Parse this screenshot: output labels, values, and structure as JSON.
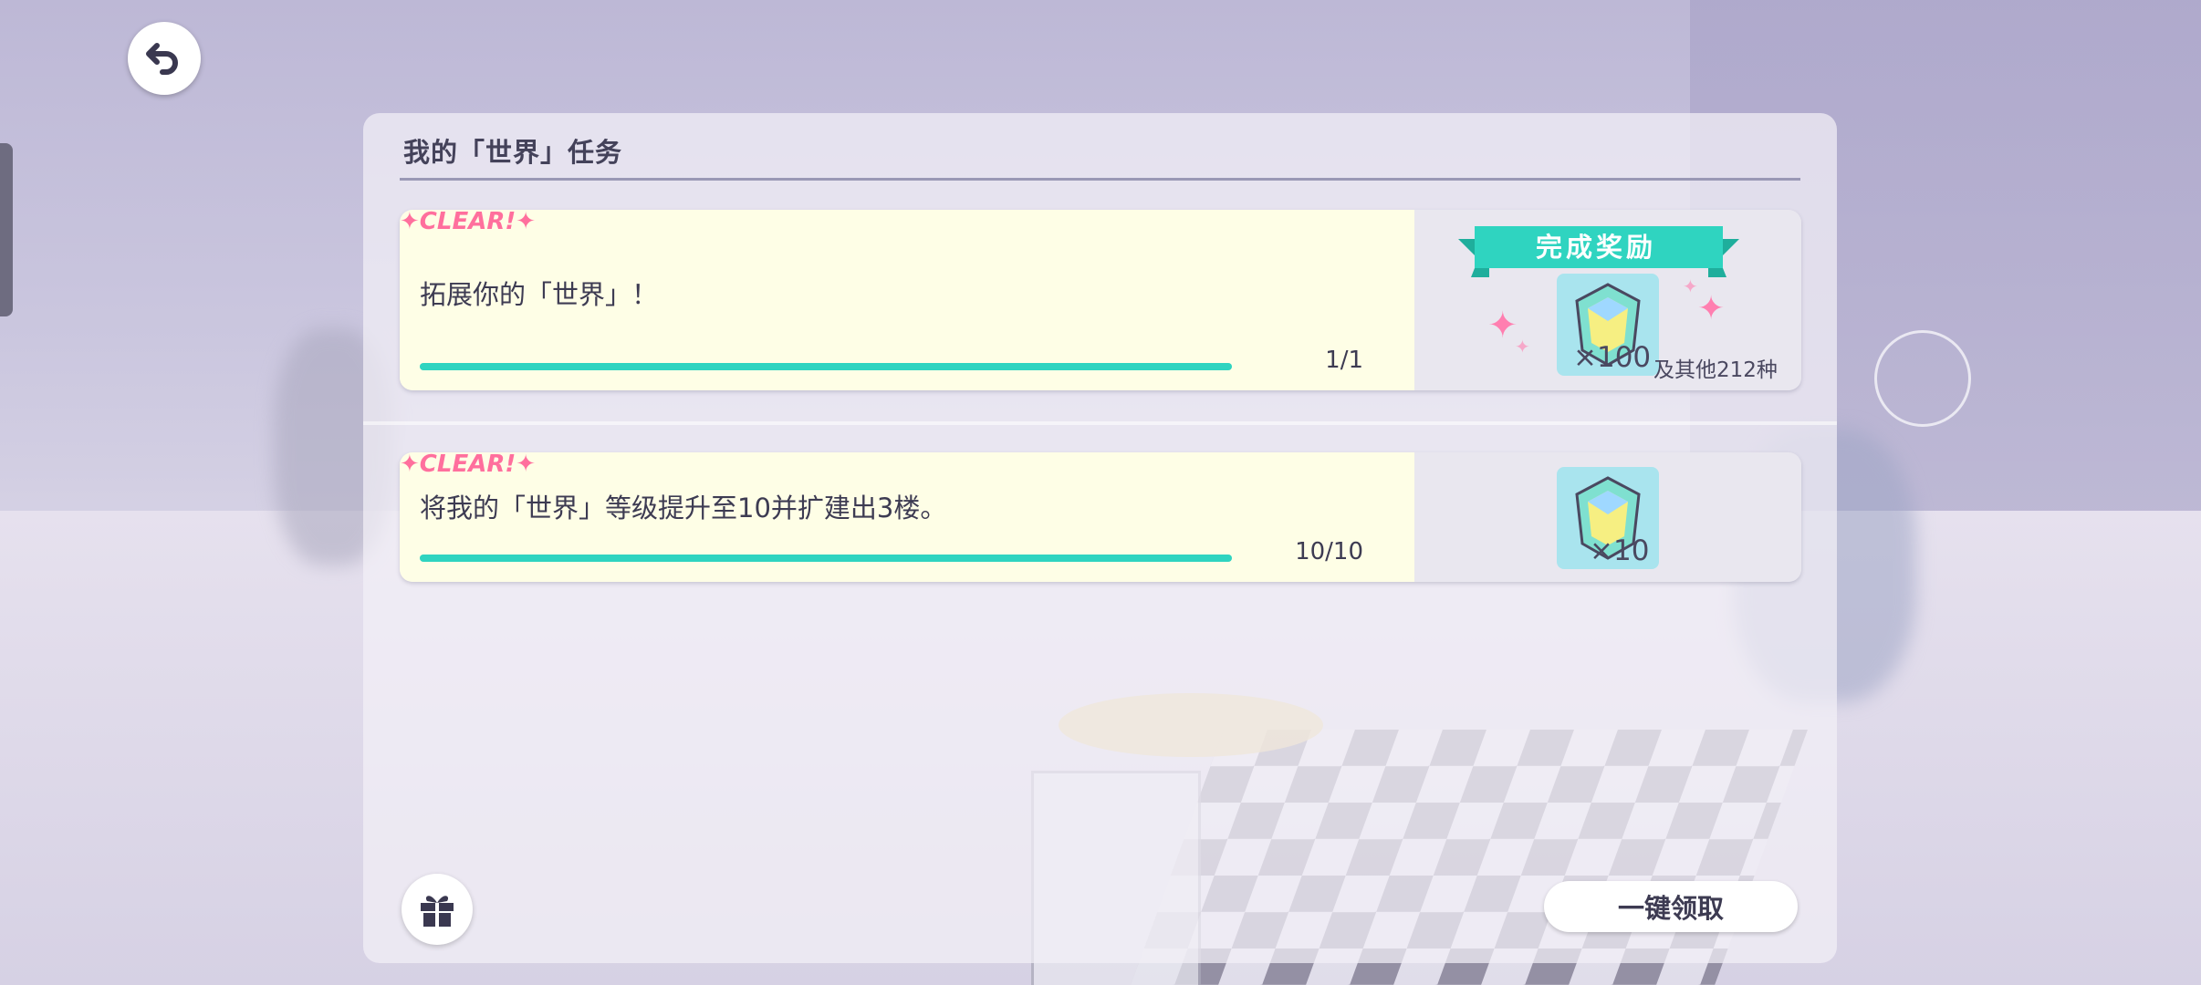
{
  "panel": {
    "title": "我的「世界」任务"
  },
  "missions": [
    {
      "badge": "CLEAR!",
      "text": "拓展你的「世界」！",
      "progress": "1/1",
      "progress_fraction": 1.0,
      "reward": {
        "header": "完成奖励",
        "qty": "×100",
        "extra": "及其他212种",
        "icon": "gem-icon"
      }
    },
    {
      "badge": "CLEAR!",
      "text": "将我的「世界」等级提升至10并扩建出3楼。",
      "progress": "10/10",
      "progress_fraction": 1.0,
      "reward": {
        "qty": "×10",
        "icon": "gem-icon"
      }
    }
  ],
  "buttons": {
    "back": {
      "icon": "back-arrow-icon"
    },
    "gift": {
      "icon": "gift-icon"
    },
    "claim_all": "一键领取"
  },
  "colors": {
    "accent": "#2fd4c0",
    "clear_pink": "#ff6f9d",
    "card_bg": "#fefee6",
    "gem_bg": "#a9e4ee"
  }
}
